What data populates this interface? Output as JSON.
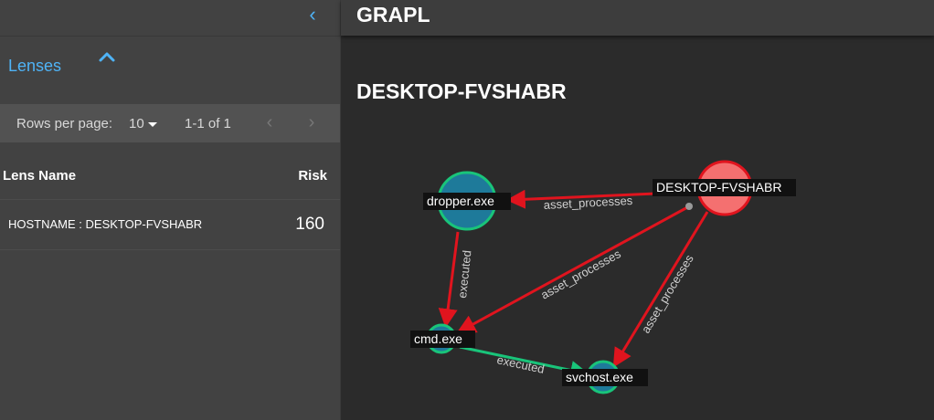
{
  "app": {
    "title": "GRAPL"
  },
  "sidebar": {
    "collapse_icon": "chevron-left-icon",
    "lenses_label": "Lenses",
    "lenses_toggle_icon": "chevron-up-icon",
    "pagination": {
      "rows_per_page_label": "Rows per page:",
      "rows_per_page_value": "10",
      "range": "1-1 of 1"
    },
    "table": {
      "headers": {
        "name": "Lens Name",
        "risk": "Risk"
      },
      "rows": [
        {
          "name": "HOSTNAME : DESKTOP-FVSHABR",
          "risk": "160"
        }
      ]
    }
  },
  "main": {
    "title": "DESKTOP-FVSHABR",
    "graph": {
      "nodes": [
        {
          "id": "desktop",
          "label": "DESKTOP-FVSHABR",
          "color": "#f47070"
        },
        {
          "id": "dropper",
          "label": "dropper.exe",
          "color": "#1e7a9a"
        },
        {
          "id": "cmd",
          "label": "cmd.exe",
          "color": "#1e7a9a"
        },
        {
          "id": "svchost",
          "label": "svchost.exe",
          "color": "#1e7a9a"
        }
      ],
      "edges": [
        {
          "from": "desktop",
          "to": "dropper",
          "label": "asset_processes",
          "color": "#e0141e"
        },
        {
          "from": "desktop",
          "to": "cmd",
          "label": "asset_processes",
          "color": "#e0141e"
        },
        {
          "from": "desktop",
          "to": "svchost",
          "label": "asset_processes",
          "color": "#e0141e"
        },
        {
          "from": "dropper",
          "to": "cmd",
          "label": "executed",
          "color": "#e0141e"
        },
        {
          "from": "cmd",
          "to": "svchost",
          "label": "executed",
          "color": "#19c47a"
        }
      ]
    }
  }
}
